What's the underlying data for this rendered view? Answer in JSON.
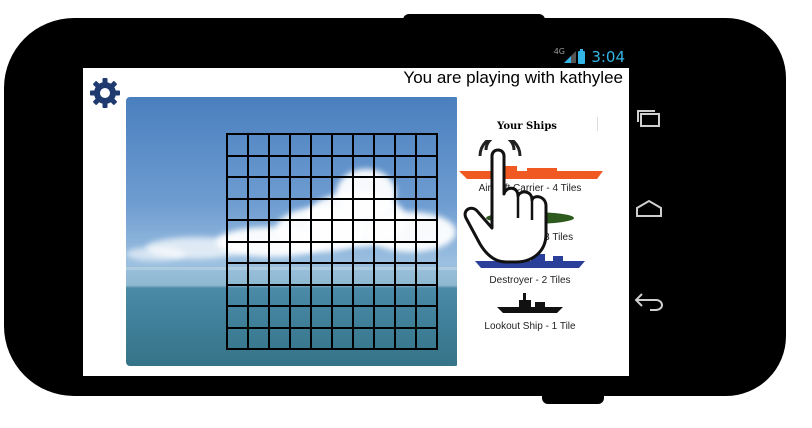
{
  "status_bar": {
    "network": "4G",
    "time": "3:04",
    "battery_color": "#33b5e5"
  },
  "app": {
    "settings_icon": "gear-icon",
    "playing_text": "You are playing with kathylee",
    "board": {
      "rows": 10,
      "columns": 10,
      "background": "sea-and-sky-photo"
    },
    "ships_panel": {
      "title": "Your Ships",
      "ships": [
        {
          "label": "Aircraft Carrier - 4 Tiles",
          "color": "#f05a22",
          "icon": "aircraft-carrier-icon"
        },
        {
          "label": "Submarine - 3 Tiles",
          "color": "#2f5a1e",
          "icon": "submarine-icon"
        },
        {
          "label": "Destroyer - 2 Tiles",
          "color": "#2a3f9a",
          "icon": "destroyer-icon"
        },
        {
          "label": "Lookout Ship - 1 Tile",
          "color": "#111111",
          "icon": "lookout-ship-icon"
        }
      ]
    },
    "gesture_hint_icon": "tap-hand-icon"
  },
  "system_nav": {
    "recent_icon": "recent-apps-icon",
    "home_icon": "home-icon",
    "back_icon": "back-icon"
  }
}
